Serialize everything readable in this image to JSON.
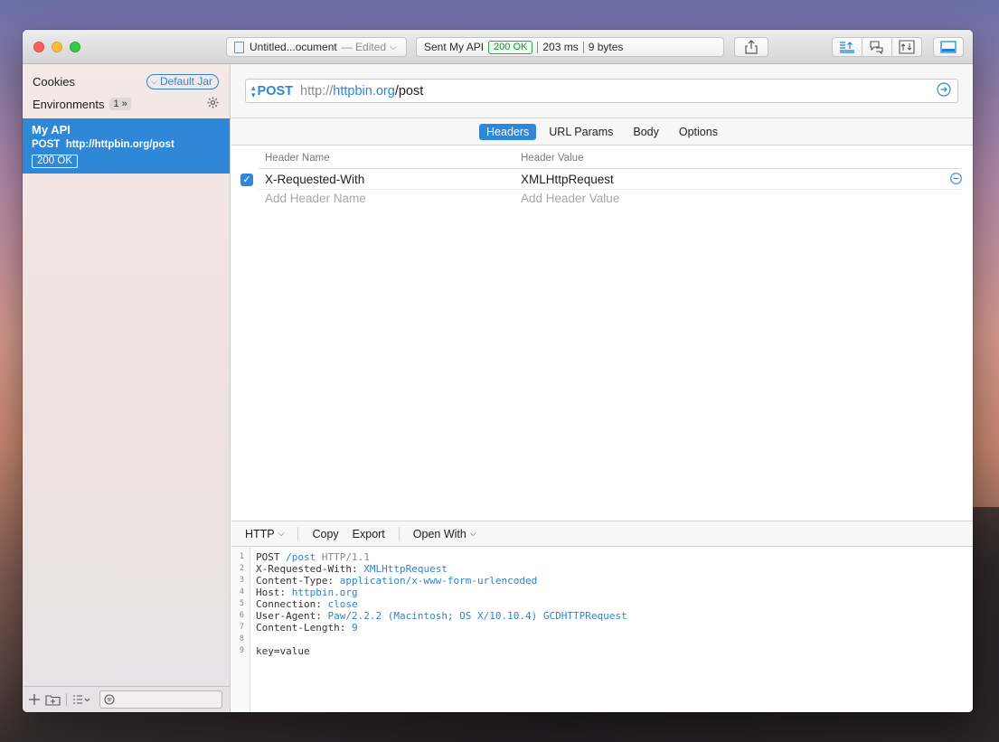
{
  "titlebar": {
    "document_name": "Untitled...ocument",
    "edited_label": "— Edited",
    "sent_label": "Sent",
    "request_name": "My API",
    "status_badge": "200 OK",
    "duration": "203 ms",
    "size": "9 bytes"
  },
  "sidebar": {
    "cookies_label": "Cookies",
    "jar_label": "Default Jar",
    "environments_label": "Environments",
    "env_count": "1",
    "env_chevron": "»",
    "request": {
      "name": "My API",
      "method": "POST",
      "url": "http://httpbin.org/post",
      "status": "200 OK"
    }
  },
  "urlbar": {
    "method": "POST",
    "scheme": "http://",
    "host": "httpbin.org",
    "path": "/post"
  },
  "tabs": [
    {
      "label": "Headers",
      "active": true
    },
    {
      "label": "URL Params",
      "active": false
    },
    {
      "label": "Body",
      "active": false
    },
    {
      "label": "Options",
      "active": false
    }
  ],
  "headers_table": {
    "col_name": "Header Name",
    "col_value": "Header Value",
    "rows": [
      {
        "name": "X-Requested-With",
        "value": "XMLHttpRequest",
        "enabled": true
      }
    ],
    "add_name_placeholder": "Add Header Name",
    "add_value_placeholder": "Add Header Value"
  },
  "response_toolbar": {
    "format": "HTTP",
    "copy": "Copy",
    "export": "Export",
    "open_with": "Open With"
  },
  "code": {
    "lines": [
      {
        "n": "1",
        "k": "POST ",
        "v": "/post",
        "g": " HTTP/1.1"
      },
      {
        "n": "2",
        "k": "X-Requested-With: ",
        "v": "XMLHttpRequest",
        "g": ""
      },
      {
        "n": "3",
        "k": "Content-Type: ",
        "v": "application/x-www-form-urlencoded",
        "g": ""
      },
      {
        "n": "4",
        "k": "Host: ",
        "v": "httpbin.org",
        "g": ""
      },
      {
        "n": "5",
        "k": "Connection: ",
        "v": "close",
        "g": ""
      },
      {
        "n": "6",
        "k": "User-Agent: ",
        "v": "Paw/2.2.2 (Macintosh; OS X/10.10.4) GCDHTTPRequest",
        "g": ""
      },
      {
        "n": "7",
        "k": "Content-Length: ",
        "v": "9",
        "g": ""
      },
      {
        "n": "8",
        "k": "",
        "v": "",
        "g": ""
      },
      {
        "n": "9",
        "k": "key=value",
        "v": "",
        "g": ""
      }
    ]
  },
  "colors": {
    "accent": "#2e87d7",
    "status_green": "#2fa54a"
  }
}
